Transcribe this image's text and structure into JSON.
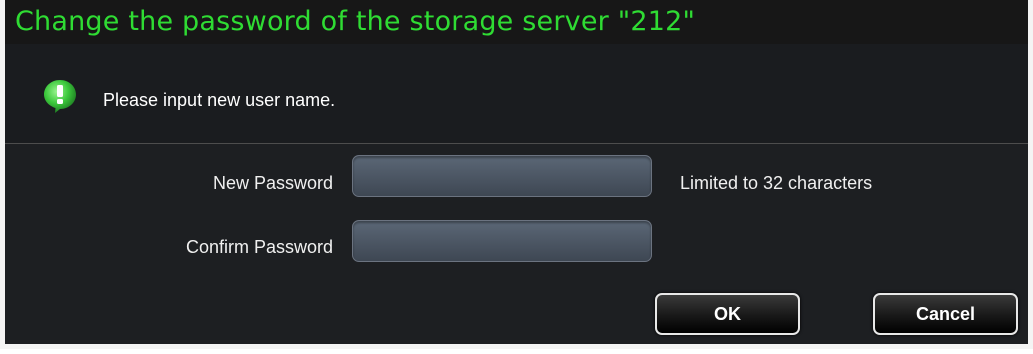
{
  "dialog": {
    "title": "Change the password of the storage server \"212\"",
    "info_icon": "info-exclamation-icon",
    "info_message": "Please input new user name."
  },
  "form": {
    "new_password_label": "New Password",
    "new_password_value": "",
    "confirm_password_label": "Confirm Password",
    "confirm_password_value": "",
    "limit_hint": "Limited to 32 characters"
  },
  "buttons": {
    "ok_label": "OK",
    "cancel_label": "Cancel"
  },
  "colors": {
    "title": "#2fdc33",
    "background": "#1d1f22",
    "icon_green": "#3cc83c"
  }
}
